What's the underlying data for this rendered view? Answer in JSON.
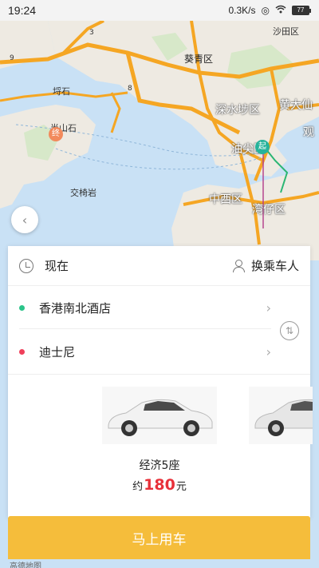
{
  "status_bar": {
    "time": "19:24",
    "network_speed": "0.3K/s",
    "battery": "77"
  },
  "map": {
    "labels": {
      "sha_tin": "沙田区",
      "kwai_tsing": "葵青区",
      "sham_shui_po": "深水埗区",
      "wong_tai_sin": "黄大仙",
      "kwun_tong": "观",
      "yau_tsim": "油尖区",
      "central_western": "中西区",
      "wan_chai": "湾仔区",
      "lo_shek": "埒石",
      "pui_o": "半山石",
      "kau_yi_chau": "交椅岩",
      "route_3": "3",
      "route_8": "8",
      "route_9": "9"
    },
    "start_marker": "起",
    "end_marker": "终",
    "back_icon": "chevron-left-icon"
  },
  "trip": {
    "time_label": "现在",
    "change_rider": "换乘车人",
    "start_location": "香港南北酒店",
    "end_location": "迪士尼",
    "swap_icon": "swap-icon"
  },
  "car": {
    "name": "经济5座",
    "price_prefix": "约",
    "price": "180",
    "price_suffix": "元"
  },
  "cta": {
    "label": "马上用车"
  },
  "map_brand": "高德地图",
  "colors": {
    "accent": "#f5bd3b",
    "price": "#e8313a",
    "start_dot": "#2bc48a",
    "end_dot": "#ef3f5a"
  }
}
